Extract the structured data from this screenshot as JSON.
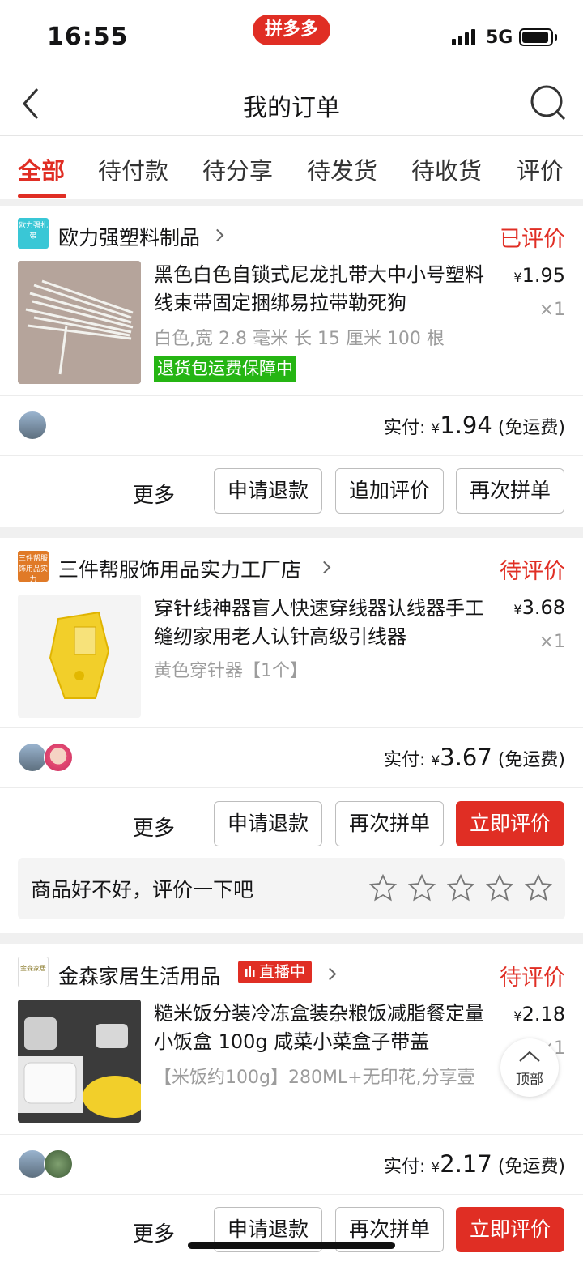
{
  "status_bar": {
    "time": "16:55",
    "brand": "拼多多",
    "network": "5G"
  },
  "nav": {
    "title": "我的订单"
  },
  "tabs": [
    "全部",
    "待付款",
    "待分享",
    "待发货",
    "待收货",
    "评价"
  ],
  "orders": [
    {
      "shop_name": "欧力强塑料制品",
      "shop_logo_text": "欧力强扎带",
      "status": "已评价",
      "title": "黑色白色自锁式尼龙扎带大中小号塑料线束带固定捆绑易拉带勒死狗",
      "price": "1.95",
      "qty": "×1",
      "spec": "白色,宽 2.8 毫米 长 15 厘米 100 根",
      "badge": "退货包运费保障中",
      "paid_label": "实付:",
      "paid_amount": "1.94",
      "shipping": "(免运费)",
      "more": "更多",
      "buttons": [
        "申请退款",
        "追加评价",
        "再次拼单"
      ]
    },
    {
      "shop_name": "三件帮服饰用品实力工厂店",
      "shop_logo_text": "三件帮服饰用品实力",
      "status": "待评价",
      "title": "穿针线神器盲人快速穿线器认线器手工缝纫家用老人认针高级引线器",
      "price": "3.68",
      "qty": "×1",
      "spec": "黄色穿针器【1个】",
      "paid_label": "实付:",
      "paid_amount": "3.67",
      "shipping": "(免运费)",
      "more": "更多",
      "buttons": [
        "申请退款",
        "再次拼单",
        "立即评价"
      ],
      "review_prompt": "商品好不好，评价一下吧"
    },
    {
      "shop_name": "金森家居生活用品",
      "shop_logo_text": "金森家居",
      "live_badge": "直播中",
      "status": "待评价",
      "title": "糙米饭分装冷冻盒装杂粮饭减脂餐定量小饭盒 100g 咸菜小菜盒子带盖",
      "price": "2.18",
      "qty": "×1",
      "spec": "【米饭约100g】280ML+无印花,分享壹",
      "paid_label": "实付:",
      "paid_amount": "2.17",
      "shipping": "(免运费)",
      "more": "更多",
      "buttons": [
        "申请退款",
        "再次拼单",
        "立即评价"
      ]
    }
  ],
  "currency": "¥",
  "back_to_top": "顶部",
  "colors": {
    "accent": "#e02e24",
    "badge_green": "#25b513"
  }
}
